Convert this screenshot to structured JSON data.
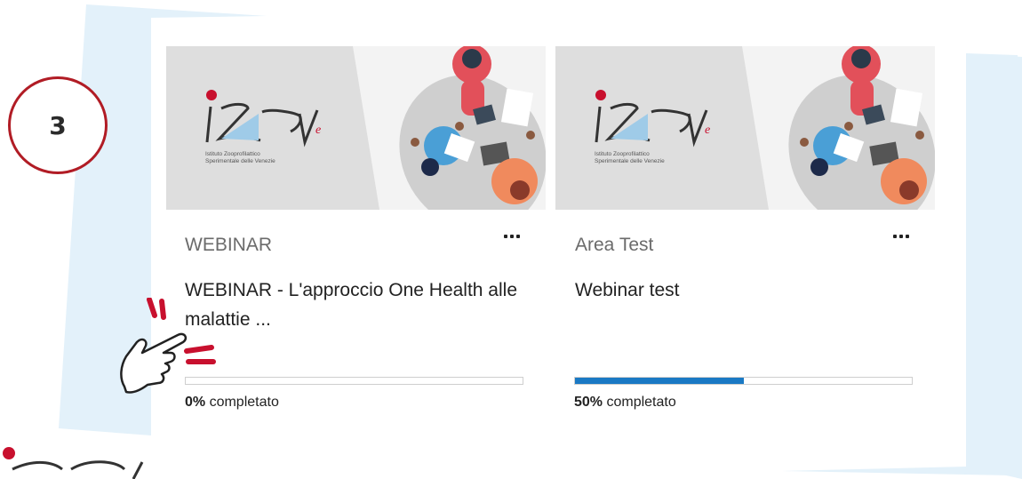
{
  "step": {
    "number": "3"
  },
  "courses": [
    {
      "category": "WEBINAR",
      "title": "WEBINAR - L'approccio One Health alle malattie ...",
      "progress_value": "0%",
      "progress_suffix": " completato",
      "progress_fraction": 0.0,
      "image_logo_text": "Istituto Zooprofilattico Sperimentale delle Venezie"
    },
    {
      "category": "Area Test",
      "title": "Webinar test",
      "progress_value": "50%",
      "progress_suffix": " completato",
      "progress_fraction": 0.5,
      "image_logo_text": "Istituto Zooprofilattico Sperimentale delle Venezie"
    }
  ],
  "colors": {
    "accent_red": "#b11c25",
    "progress_blue": "#1a79c4",
    "background_blue": "#e3f1fa"
  },
  "icons": [
    "menu-dots-icon",
    "pointing-hand-icon",
    "izsve-logo"
  ]
}
